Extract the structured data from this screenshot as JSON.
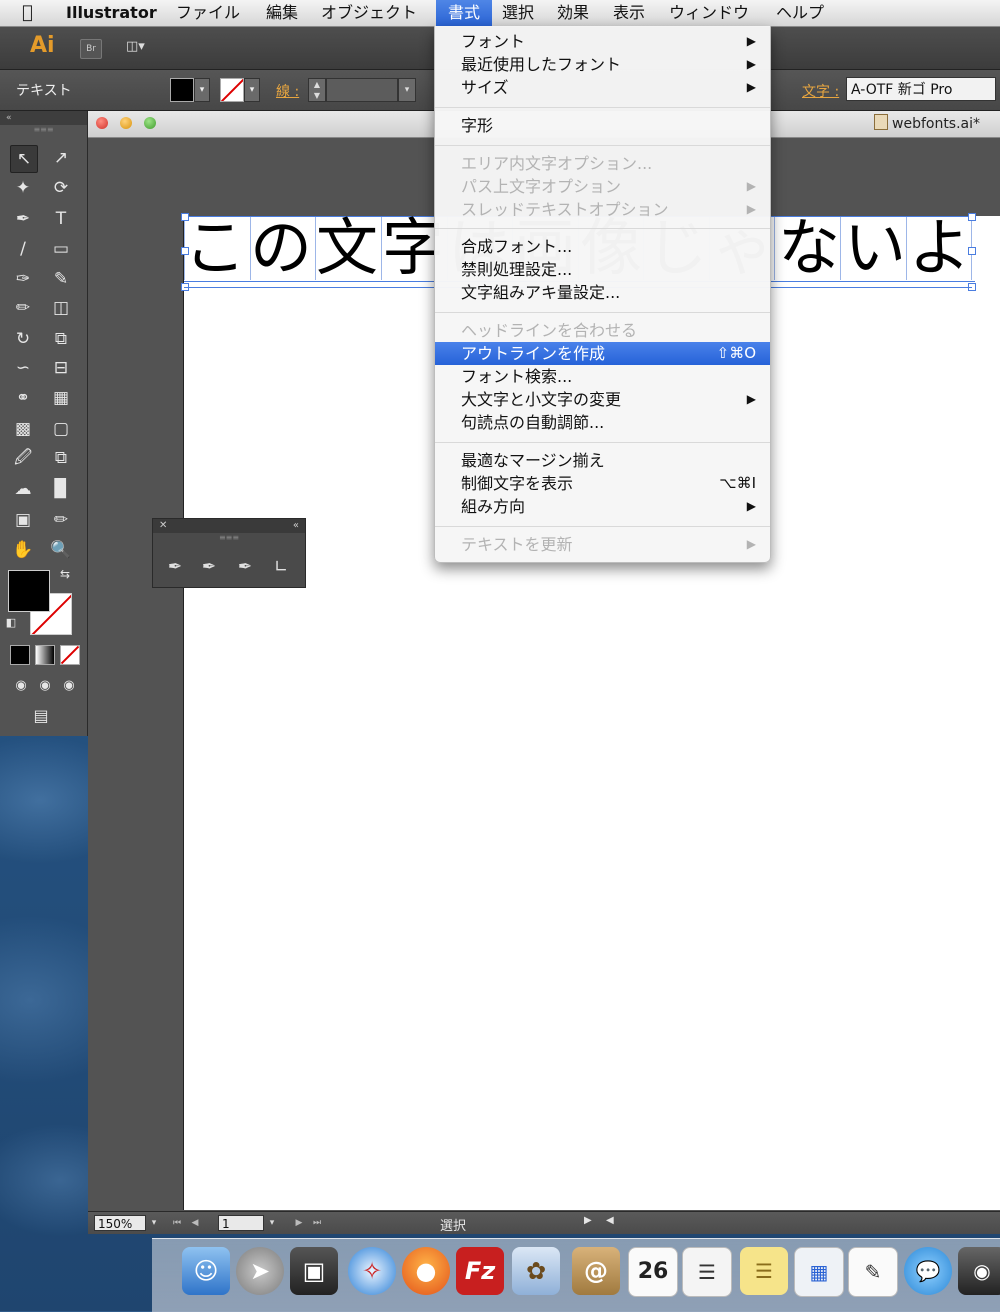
{
  "menubar": {
    "app_name": "Illustrator",
    "items": [
      {
        "label": "ファイル"
      },
      {
        "label": "編集"
      },
      {
        "label": "オブジェクト"
      },
      {
        "label": "書式"
      },
      {
        "label": "選択"
      },
      {
        "label": "効果"
      },
      {
        "label": "表示"
      },
      {
        "label": "ウィンドウ"
      },
      {
        "label": "ヘルプ"
      }
    ],
    "active_menu": "書式"
  },
  "appbar": {
    "logo": "Ai",
    "bridge_label": "Br"
  },
  "control_bar": {
    "mode_label": "テキスト",
    "stroke_label": "線 :",
    "font_label": "文字 :",
    "font_value": "A-OTF 新ゴ Pro"
  },
  "document": {
    "tab_title": "webfonts.ai*",
    "artwork_text": "この文字は画像じゃないよ"
  },
  "status_bar": {
    "zoom": "150%",
    "page": "1",
    "status_text": "選択"
  },
  "dropdown": {
    "items": [
      {
        "label": "フォント",
        "submenu": true,
        "disabled": false
      },
      {
        "label": "最近使用したフォント",
        "submenu": true,
        "disabled": false
      },
      {
        "label": "サイズ",
        "submenu": true,
        "disabled": false
      },
      {
        "label": "字形",
        "submenu": false,
        "disabled": false
      },
      {
        "label": "エリア内文字オプション...",
        "submenu": false,
        "disabled": true
      },
      {
        "label": "パス上文字オプション",
        "submenu": true,
        "disabled": true
      },
      {
        "label": "スレッドテキストオプション",
        "submenu": true,
        "disabled": true
      },
      {
        "label": "合成フォント...",
        "submenu": false,
        "disabled": false
      },
      {
        "label": "禁則処理設定...",
        "submenu": false,
        "disabled": false
      },
      {
        "label": "文字組みアキ量設定...",
        "submenu": false,
        "disabled": false
      },
      {
        "label": "ヘッドラインを合わせる",
        "submenu": false,
        "disabled": true
      },
      {
        "label": "アウトラインを作成",
        "shortcut": "⇧⌘O",
        "highlighted": true
      },
      {
        "label": "フォント検索...",
        "submenu": false,
        "disabled": false
      },
      {
        "label": "大文字と小文字の変更",
        "submenu": true,
        "disabled": false
      },
      {
        "label": "句読点の自動調節...",
        "submenu": false,
        "disabled": false
      },
      {
        "label": "最適なマージン揃え",
        "submenu": false,
        "disabled": false
      },
      {
        "label": "制御文字を表示",
        "shortcut": "⌥⌘I"
      },
      {
        "label": "組み方向",
        "submenu": true,
        "disabled": false
      },
      {
        "label": "テキストを更新",
        "submenu": true,
        "disabled": true
      }
    ]
  },
  "dock": {
    "calendar_day": "26"
  },
  "colors": {
    "accent_highlight": "#2a63d4",
    "control_label_orange": "#e8a640",
    "selection_blue": "#4a7de0"
  }
}
